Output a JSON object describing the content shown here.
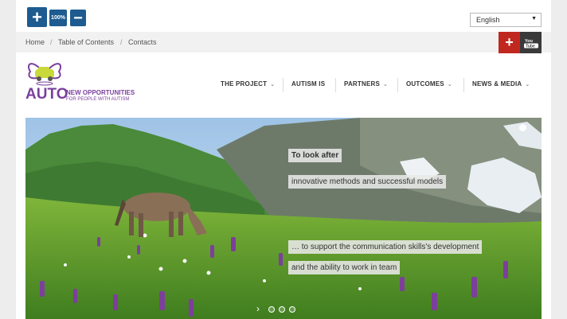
{
  "accessibility": {
    "zoom_in_label": "+",
    "zoom_level": "100%",
    "zoom_out_label": "−"
  },
  "language": {
    "selected": "English"
  },
  "breadcrumb": {
    "items": [
      "Home",
      "Table of Contents",
      "Contacts"
    ],
    "separator": "/"
  },
  "social": {
    "gplus_label": "+"
  },
  "logo": {
    "word": "AUTO",
    "tagline_1": "NEW OPPORTUNITIES",
    "tagline_2": "FOR PEOPLE WITH AUTISM"
  },
  "nav": {
    "items": [
      {
        "label": "THE PROJECT",
        "dropdown": true
      },
      {
        "label": "AUTISM IS",
        "dropdown": false
      },
      {
        "label": "PARTNERS",
        "dropdown": true
      },
      {
        "label": "OUTCOMES",
        "dropdown": true
      },
      {
        "label": "NEWS & MEDIA",
        "dropdown": true
      }
    ]
  },
  "slider": {
    "captions": [
      "To look after",
      "innovative methods and successful models",
      "… to support the communication skills's development",
      "and the ability to work in team"
    ],
    "slide_count": 3,
    "active_index": 0
  },
  "colors": {
    "brand_purple": "#7a3f9d",
    "zoom_blue": "#1d5b90",
    "gplus_red": "#c0281f",
    "youtube_dark": "#3a3a3a"
  }
}
